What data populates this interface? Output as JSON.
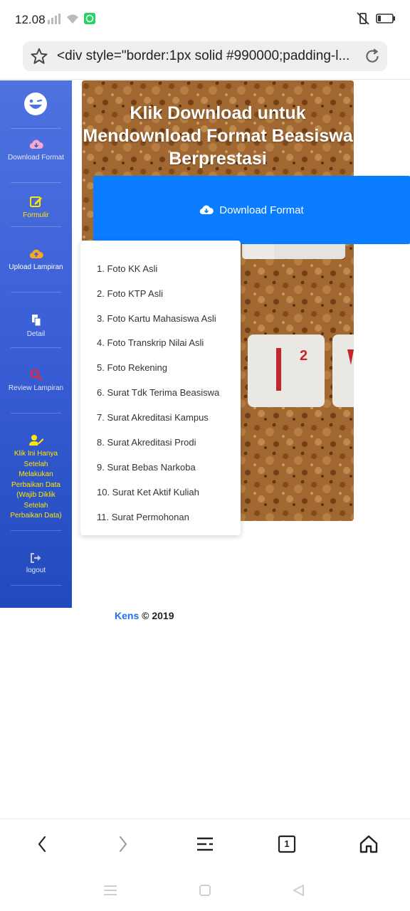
{
  "status": {
    "time": "12.08"
  },
  "address_bar": {
    "url_text": "<div style=\"border:1px solid #990000;padding-l..."
  },
  "sidebar": {
    "items": [
      {
        "label": "Download Format",
        "icon": "cloud-download-icon",
        "color": "#f7a8c8"
      },
      {
        "label": "Formulir",
        "icon": "edit-icon",
        "color": "#ffe600"
      },
      {
        "label": "Upload Lampiran",
        "icon": "cloud-upload-icon",
        "color": "#f6a623"
      },
      {
        "label": "Detail",
        "icon": "copy-icon",
        "color": "#ffffff"
      },
      {
        "label": "Review Lampiran",
        "icon": "search-icon",
        "color": "#e8273b"
      },
      {
        "label": "Klik Ini Hanya Setelah Melakukan Perbaikan Data (Wajib Diklik Setelah Perbaikan Data)",
        "icon": "user-edit-icon",
        "color": "#ffe600"
      },
      {
        "label": "logout",
        "icon": "sign-out-icon",
        "color": "#c7c7d8"
      }
    ]
  },
  "hero": {
    "title": "Klik Download untuk Mendownload Format Beasiswa Berprestasi"
  },
  "download_button": {
    "label": "Download Format"
  },
  "dropdown": {
    "items": [
      "1. Foto KK Asli",
      "2. Foto KTP Asli",
      "3. Foto Kartu Mahasiswa Asli",
      "4. Foto Transkrip Nilai Asli",
      "5. Foto Rekening",
      "6. Surat Tdk Terima Beasiswa",
      "7. Surat Akreditasi Kampus",
      "8. Surat Akreditasi Prodi",
      "9. Surat Bebas Narkoba",
      "10. Surat Ket Aktif Kuliah",
      "11. Surat Permohonan"
    ]
  },
  "footer": {
    "brand": "Kens",
    "copyright": "© 2019"
  },
  "toolbar": {
    "tab_count": "1"
  },
  "colors": {
    "sidebar_top": "#4e73df",
    "sidebar_bottom": "#224abe",
    "button_blue": "#0a7cff",
    "brand_link": "#1a73e8"
  }
}
